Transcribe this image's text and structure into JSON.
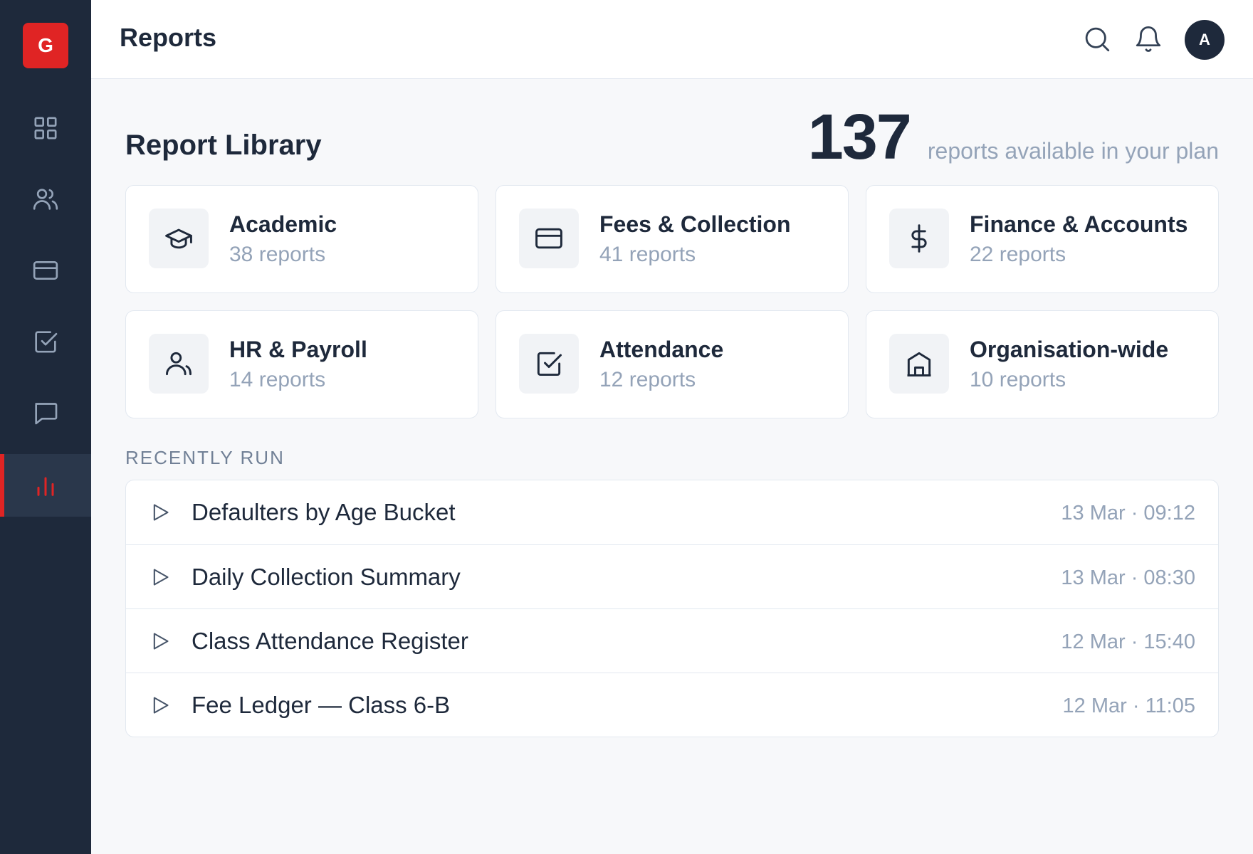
{
  "sidebar": {
    "logo_letter": "G",
    "items": [
      {
        "name": "dashboard",
        "icon": "grid-icon"
      },
      {
        "name": "people",
        "icon": "users-icon"
      },
      {
        "name": "fees",
        "icon": "credit-card-icon"
      },
      {
        "name": "attendance",
        "icon": "check-square-icon"
      },
      {
        "name": "messages",
        "icon": "message-icon"
      },
      {
        "name": "reports",
        "icon": "bar-chart-icon",
        "active": true
      }
    ],
    "accent": "#e02424",
    "background": "#1e293b"
  },
  "header": {
    "title": "Reports",
    "avatar_letter": "A"
  },
  "library": {
    "title": "Report Library",
    "count": "137",
    "count_label": "reports available in your plan",
    "categories": [
      {
        "name": "Academic",
        "count": "38 reports",
        "icon": "graduation-cap-icon"
      },
      {
        "name": "Fees & Collection",
        "count": "41 reports",
        "icon": "credit-card-icon"
      },
      {
        "name": "Finance & Accounts",
        "count": "22 reports",
        "icon": "dollar-icon"
      },
      {
        "name": "HR & Payroll",
        "count": "14 reports",
        "icon": "person-icon"
      },
      {
        "name": "Attendance",
        "count": "12 reports",
        "icon": "check-square-icon"
      },
      {
        "name": "Organisation-wide",
        "count": "10 reports",
        "icon": "building-icon"
      }
    ]
  },
  "recent": {
    "label": "RECENTLY RUN",
    "items": [
      {
        "name": "Defaulters by Age Bucket",
        "time": "13 Mar · 09:12"
      },
      {
        "name": "Daily Collection Summary",
        "time": "13 Mar · 08:30"
      },
      {
        "name": "Class Attendance Register",
        "time": "12 Mar · 15:40"
      },
      {
        "name": "Fee Ledger — Class 6-B",
        "time": "12 Mar · 11:05"
      }
    ]
  }
}
